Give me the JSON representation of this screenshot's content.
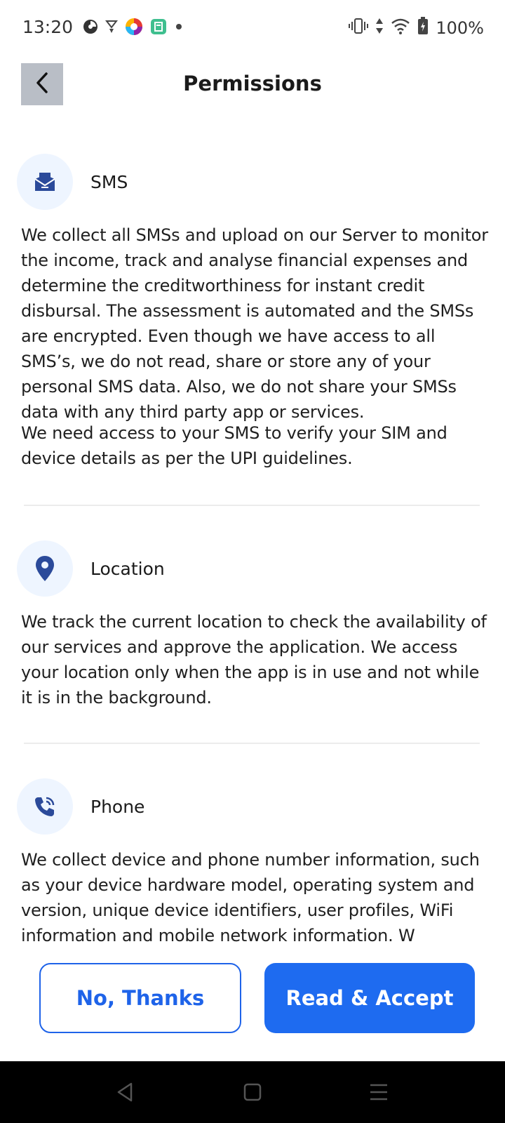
{
  "status_bar": {
    "time": "13:20",
    "battery": "100%",
    "left_icons": [
      "notification-icon",
      "vpn-icon",
      "app-icon",
      "calendar-app-icon",
      "dot-icon"
    ],
    "right_icons": [
      "vibrate-icon",
      "data-icon",
      "wifi-icon",
      "battery-icon"
    ]
  },
  "header": {
    "title": "Permissions"
  },
  "permissions": [
    {
      "title": "SMS",
      "icon": "sms-icon",
      "description": "We collect all SMSs and upload on our Server to monitor the income, track and analyse financial expenses and determine the creditworthiness for instant credit disbursal. The assessment is automated and the SMSs are encrypted. Even though we have access to all SMS’s, we do not read, share or store any of your personal SMS data. Also, we do not share your SMSs data with any third party app or services.",
      "description_2": "We need access to your SMS to verify your SIM and device details as per the UPI guidelines."
    },
    {
      "title": "Location",
      "icon": "location-icon",
      "description": "We track the current location to check the availability of our services and approve the application. We access your location only when the app is in use and not while it is in the background."
    },
    {
      "title": "Phone",
      "icon": "phone-icon",
      "description": "We collect device and phone number information, such as your device hardware model, operating system and version, unique device identifiers, user profiles, WiFi information and mobile network information. W"
    }
  ],
  "buttons": {
    "decline": "No, Thanks",
    "accept": "Read & Accept"
  },
  "colors": {
    "accent": "#1e6bf0",
    "icon_blue": "#2b4a9a",
    "icon_bg": "#eef5ff",
    "back_button_bg": "#b9bec6"
  }
}
